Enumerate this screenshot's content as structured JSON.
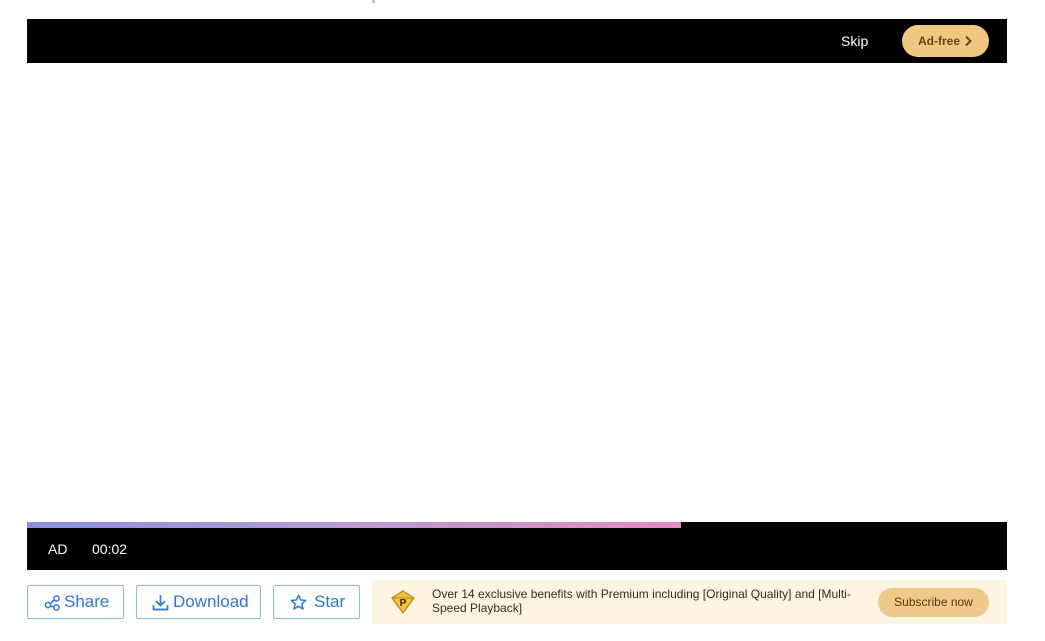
{
  "player": {
    "skip_label": "Skip",
    "adfree_label": "Ad-free",
    "ad_label": "AD",
    "ad_time": "00:02",
    "ad_progress": 0.667
  },
  "actions": {
    "share_label": "Share",
    "download_label": "Download",
    "star_label": "Star"
  },
  "premium": {
    "badge_letter": "P",
    "description": "Over 14 exclusive benefits with Premium including [Original Quality] and [Multi-Speed Playback]",
    "subscribe_label": "Subscribe now"
  },
  "icons": {
    "adfree": "chevron-right-icon",
    "share": "share-icon",
    "download": "download-icon",
    "star": "star-icon",
    "premium": "premium-badge-icon"
  },
  "colors": {
    "accent_blue": "#2f76de",
    "gold": "#f0c77f",
    "banner_bg": "#fdf4e2"
  }
}
